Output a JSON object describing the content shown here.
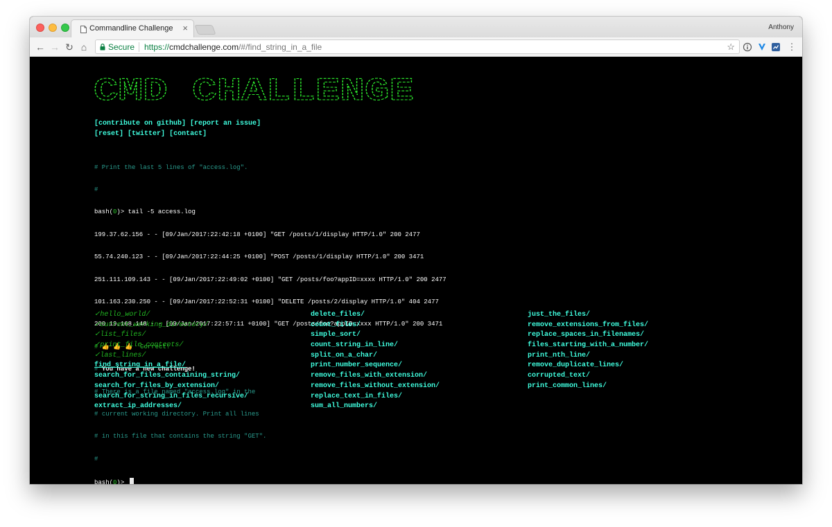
{
  "browser": {
    "tab_title": "Commandline Challenge",
    "tab_close": "×",
    "profile_name": "Anthony",
    "secure_label": "Secure",
    "url_scheme": "https://",
    "url_host": "cmdchallenge.com",
    "url_path": "/#/find_string_in_a_file",
    "nav": {
      "back": "←",
      "forward": "→",
      "reload": "↻",
      "home": "⌂"
    },
    "star": "☆",
    "menu": "⋮"
  },
  "banner_text": "CMD CHALLENGE",
  "links": {
    "github": "[contribute on github]",
    "issue": "[report an issue]",
    "reset": "[reset]",
    "twitter": "[twitter]",
    "contact": "[contact]"
  },
  "terminal": {
    "task_comment": "# Print the last 5 lines of \"access.log\".",
    "hash": "#",
    "prompt_pre": "bash(",
    "prompt_code": "0",
    "prompt_post": ")> ",
    "command": "tail -5 access.log",
    "output": [
      "199.37.62.156 - - [09/Jan/2017:22:42:18 +0100] \"GET /posts/1/display HTTP/1.0\" 200 2477",
      "55.74.240.123 - - [09/Jan/2017:22:44:25 +0100] \"POST /posts/1/display HTTP/1.0\" 200 3471",
      "251.111.109.143 - - [09/Jan/2017:22:49:02 +0100] \"GET /posts/foo?appID=xxxx HTTP/1.0\" 200 2477",
      "101.163.230.250 - - [09/Jan/2017:22:52:31 +0100] \"DELETE /posts/2/display HTTP/1.0\" 404 2477",
      "200.19.168.148 - - [09/Jan/2017:22:57:11 +0100] \"GET /posts/foo?appID=xxxx HTTP/1.0\" 200 3471"
    ],
    "correct_emojis": "👍 👍 👍",
    "correct_text": "Correct!",
    "new_challenge": "You have a new challenge!",
    "challenge_lines": [
      "There is a file named \"access.log\" in the",
      "current working directory. Print all lines",
      "in this file that contains the string \"GET\"."
    ]
  },
  "challenges": {
    "col1": [
      {
        "label": "✓hello_world/",
        "status": "done"
      },
      {
        "label": "✓current_working_directory/",
        "status": "done"
      },
      {
        "label": "✓list_files/",
        "status": "done"
      },
      {
        "label": "✓print_file_contents/",
        "status": "done"
      },
      {
        "label": "✓last_lines/",
        "status": "done"
      },
      {
        "label": "find_string_in_a_file/",
        "status": "current"
      },
      {
        "label": "search_for_files_containing_string/",
        "status": "todo"
      },
      {
        "label": "search_for_files_by_extension/",
        "status": "todo"
      },
      {
        "label": "search_for_string_in_files_recursive/",
        "status": "todo"
      },
      {
        "label": "extract_ip_addresses/",
        "status": "todo"
      }
    ],
    "col2": [
      {
        "label": "delete_files/",
        "status": "todo"
      },
      {
        "label": "count_files/",
        "status": "todo"
      },
      {
        "label": "simple_sort/",
        "status": "todo"
      },
      {
        "label": "count_string_in_line/",
        "status": "todo"
      },
      {
        "label": "split_on_a_char/",
        "status": "todo"
      },
      {
        "label": "print_number_sequence/",
        "status": "todo"
      },
      {
        "label": "remove_files_with_extension/",
        "status": "todo"
      },
      {
        "label": "remove_files_without_extension/",
        "status": "todo"
      },
      {
        "label": "replace_text_in_files/",
        "status": "todo"
      },
      {
        "label": "sum_all_numbers/",
        "status": "todo"
      }
    ],
    "col3": [
      {
        "label": "just_the_files/",
        "status": "todo"
      },
      {
        "label": "remove_extensions_from_files/",
        "status": "todo"
      },
      {
        "label": "replace_spaces_in_filenames/",
        "status": "todo"
      },
      {
        "label": "files_starting_with_a_number/",
        "status": "todo"
      },
      {
        "label": "print_nth_line/",
        "status": "todo"
      },
      {
        "label": "remove_duplicate_lines/",
        "status": "todo"
      },
      {
        "label": "corrupted_text/",
        "status": "todo"
      },
      {
        "label": "print_common_lines/",
        "status": "todo"
      }
    ]
  },
  "colors": {
    "accent_cyan": "#40ffe0",
    "banner_green": "#2ef02e",
    "done_green": "#22b822",
    "comment_teal": "#2a9d8f"
  }
}
